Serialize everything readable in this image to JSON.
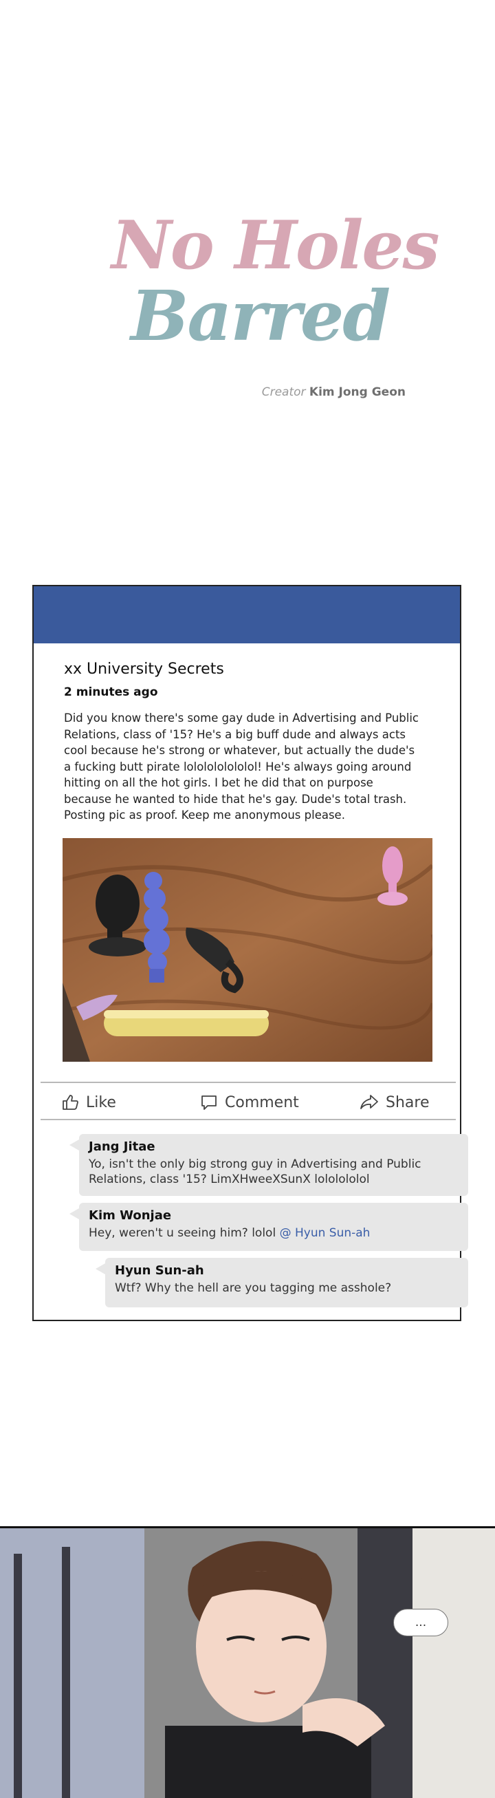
{
  "title": {
    "line1": "No Holes",
    "line2": "Barred",
    "creator_label": "Creator",
    "creator_name": "Kim Jong Geon"
  },
  "post": {
    "group_name": "xx University Secrets",
    "time": "2 minutes ago",
    "body": "Did you know there's some gay dude in Advertising and Public Relations, class of '15? He's a big buff dude and always acts cool because he's strong or whatever, but actually the dude's a fucking butt pirate lololololololol! He's always going around hitting on all the hot girls. I bet he did that on purpose because he wanted to hide that he's gay. Dude's total trash. Posting pic as proof. Keep me anonymous please.",
    "actions": {
      "like": "Like",
      "comment": "Comment",
      "share": "Share"
    },
    "comments": [
      {
        "author": "Jang Jitae",
        "text": "Yo, isn't the only big strong guy in Advertising and Public Relations, class '15? LimXHweeXSunX lololololol"
      },
      {
        "author": "Kim Wonjae",
        "text": "Hey, weren't u seeing him? lolol",
        "mention": "@ Hyun Sun-ah"
      },
      {
        "author": "Hyun Sun-ah",
        "text": "Wtf? Why the hell are you tagging me asshole?"
      }
    ]
  },
  "speech_bubble": {
    "text": "..."
  },
  "colors": {
    "header_blue": "#3a5a9c",
    "title_pink": "#d7a7b4",
    "title_teal": "#8fb3b8",
    "mention_blue": "#3a5ea8",
    "comment_bg": "#e7e7e7"
  }
}
